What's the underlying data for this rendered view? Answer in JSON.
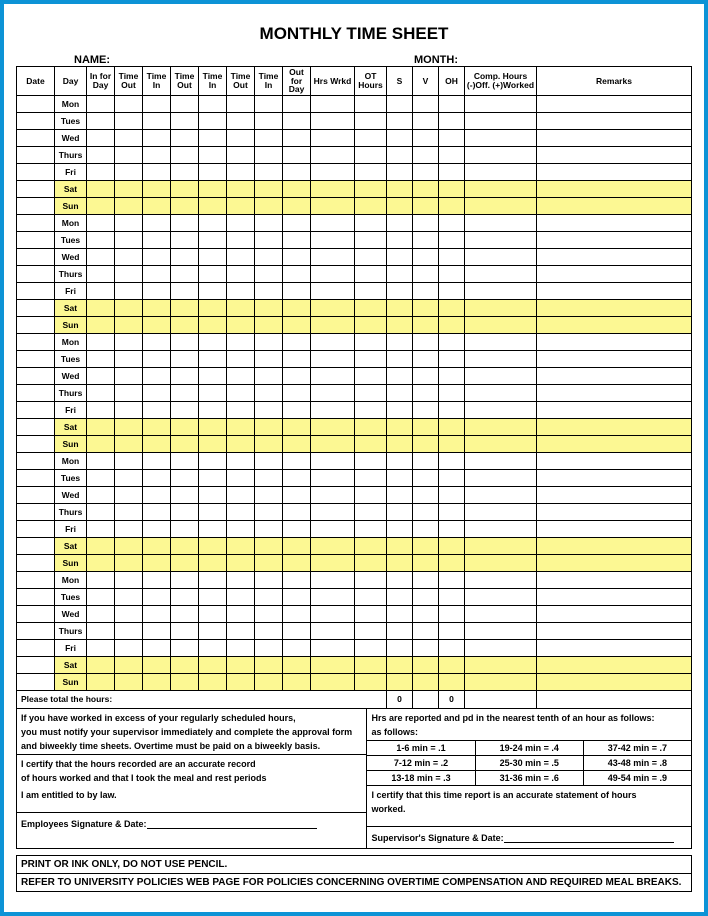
{
  "title": "MONTHLY TIME SHEET",
  "labels": {
    "name": "NAME:",
    "month": "MONTH:"
  },
  "columns": {
    "date": "Date",
    "day": "Day",
    "infor": "In for Day",
    "tout": "Time Out",
    "tin": "Time In",
    "outfor": "Out for Day",
    "hrswrkd": "Hrs Wrkd",
    "ot": "OT Hours",
    "s": "S",
    "v": "V",
    "oh": "OH",
    "comp": "Comp. Hours (-)Off. (+)Worked",
    "remarks": "Remarks"
  },
  "days": [
    "Mon",
    "Tues",
    "Wed",
    "Thurs",
    "Fri",
    "Sat",
    "Sun",
    "Mon",
    "Tues",
    "Wed",
    "Thurs",
    "Fri",
    "Sat",
    "Sun",
    "Mon",
    "Tues",
    "Wed",
    "Thurs",
    "Fri",
    "Sat",
    "Sun",
    "Mon",
    "Tues",
    "Wed",
    "Thurs",
    "Fri",
    "Sat",
    "Sun",
    "Mon",
    "Tues",
    "Wed",
    "Thurs",
    "Fri",
    "Sat",
    "Sun"
  ],
  "total": {
    "label": "Please total the hours:",
    "s": "0",
    "oh": "0"
  },
  "notes_left": {
    "l1": "If you have worked in excess of your regularly scheduled hours,",
    "l2": "you must notify your supervisor immediately and complete the approval form",
    "l3": "and biweekly time sheets. Overtime must be paid on a biweekly basis.",
    "l4": "I certify that the hours recorded are an accurate record",
    "l5": "of hours worked and that I took the meal and rest periods",
    "l6": "I am entitled to by law.",
    "sig": "Employees Signature & Date:"
  },
  "notes_right": {
    "l1": "Hrs are reported and pd in the nearest tenth of an hour as follows:",
    "l2": "as follows:",
    "m1a": "1-6 min = .1",
    "m1b": "19-24 min = .4",
    "m1c": "37-42 min = .7",
    "m2a": "7-12 min = .2",
    "m2b": "25-30 min = .5",
    "m2c": "43-48 min = .8",
    "m3a": "13-18 min = .3",
    "m3b": "31-36 min = .6",
    "m3c": "49-54 min = .9",
    "cert1": "I certify that this time report is an accurate statement of hours",
    "cert2": "worked.",
    "sig": "Supervisor's Signature & Date:"
  },
  "footer": {
    "l1": "PRINT OR INK ONLY, DO NOT USE PENCIL.",
    "l2": "REFER TO UNIVERSITY POLICIES WEB PAGE FOR POLICIES CONCERNING OVERTIME COMPENSATION AND REQUIRED MEAL BREAKS."
  }
}
